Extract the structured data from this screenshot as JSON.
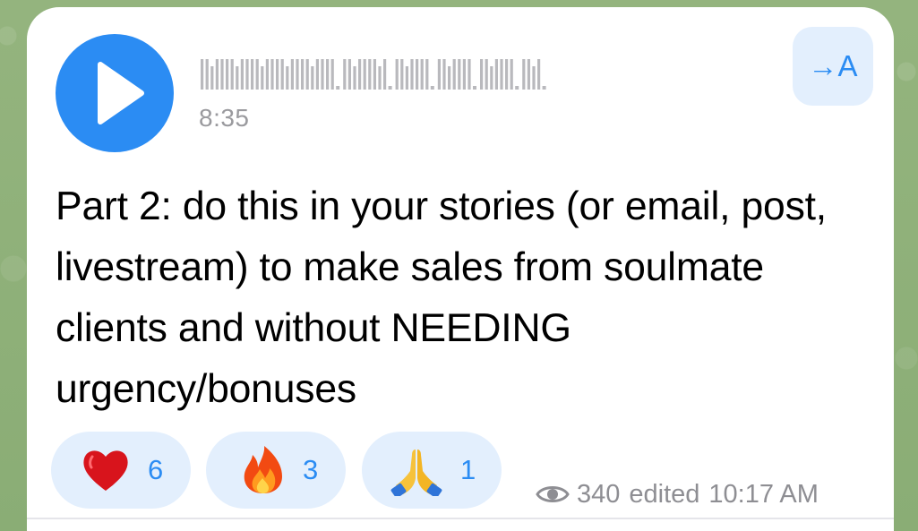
{
  "voice_message": {
    "duration": "8:35",
    "play_icon": "play-icon",
    "translate_label": "→A"
  },
  "caption": "Part 2: do this in your stories (or email, post, livestream) to make sales from soulmate clients and without NEEDING urgency/bonuses",
  "reactions": [
    {
      "emoji": "heart",
      "count": "6"
    },
    {
      "emoji": "fire",
      "count": "3"
    },
    {
      "emoji": "folded-hands",
      "count": "1"
    }
  ],
  "meta": {
    "views_icon": "eye-icon",
    "views": "340",
    "edited": "edited",
    "time": "10:17 AM"
  },
  "colors": {
    "accent": "#2b8cf3",
    "reaction_bg": "#e3effd",
    "waveform": "#b9b9bd",
    "meta_text": "#8e8e93",
    "wallpaper": "#8fb07a"
  }
}
